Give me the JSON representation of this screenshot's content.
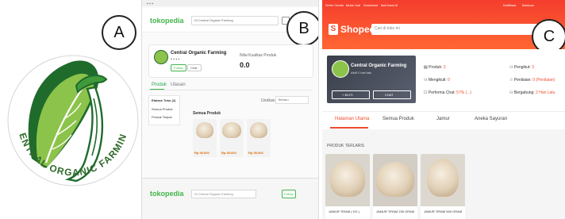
{
  "labels": {
    "a": "A",
    "b": "B",
    "c": "C"
  },
  "logo": {
    "brand_text": "CENTRAL ORGANIC FARMING",
    "colors": {
      "dark_green": "#1f6b2c",
      "light_green": "#8cc34a",
      "mid_green": "#3f9a3a"
    }
  },
  "tokopedia": {
    "logo": "tokopedia",
    "search_placeholder": "Di Central Organic Farming",
    "shop_name": "Central Organic Farming",
    "rating_label": "Nilai Kualitas Produk",
    "rating_value": "0.0",
    "tabs": [
      "Produk",
      "Ulasan"
    ],
    "etalase_title": "Etalase Toko (2)",
    "etalase_items": [
      "Semua Produk",
      "Produk Terjual"
    ],
    "section_title": "Semua Produk",
    "sort_label": "Urutkan",
    "sort_value": "Terbaru",
    "products": [
      {
        "price": "Rp 35.000"
      },
      {
        "price": "Rp 35.000"
      },
      {
        "price": "Rp 35.000"
      }
    ],
    "follow_button": "Follow",
    "chat_button": "Chat",
    "colors": {
      "brand": "#42b549"
    }
  },
  "shopee": {
    "logo": "Shopee",
    "search_placeholder": "Cari di toko ini",
    "top_links": [
      "Seller Centre",
      "Mulai Jual",
      "Download",
      "Ikuti kami di"
    ],
    "top_right": [
      "Notifikasi",
      "Bantuan"
    ],
    "shop_name": "Central Organic Farming",
    "shop_status": "Aktif 2 hari lalu",
    "follow_button": "+ IKUTI",
    "chat_button": "CHAT",
    "stats_left": [
      {
        "label": "Produk:",
        "value": "3"
      },
      {
        "label": "Mengikuti:",
        "value": "0"
      },
      {
        "label": "Performa Chat:",
        "value": "57% (...)"
      }
    ],
    "stats_right": [
      {
        "label": "Pengikut:",
        "value": "3"
      },
      {
        "label": "Penilaian:",
        "value": "0 (Penilaian)"
      },
      {
        "label": "Bergabung:",
        "value": "2 Hari Lalu"
      }
    ],
    "tabs": [
      "Halaman Utama",
      "Semua Produk",
      "Jamur",
      "Aneka Sayuran"
    ],
    "section_title": "PRODUK TERLARIS",
    "products": [
      {
        "name": "JAMUR TIRAM ( KG )"
      },
      {
        "name": "JAMUR TIRAM 230 GRAM"
      },
      {
        "name": "JAMUR TIRAM 500 GRAM"
      }
    ],
    "colors": {
      "brand": "#ee4d2d"
    }
  }
}
